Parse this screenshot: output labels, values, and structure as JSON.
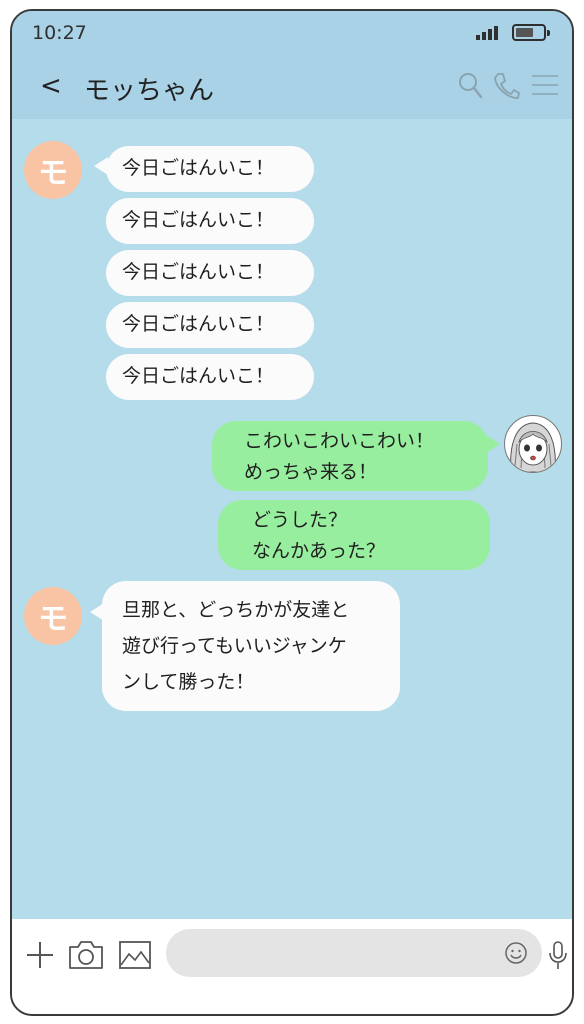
{
  "status": {
    "time": "10:27"
  },
  "header": {
    "back": "<",
    "title": "モッちゃん"
  },
  "contact": {
    "avatar_letter": "モ"
  },
  "messages": [
    {
      "side": "in",
      "text": "今日ごはんいこ！"
    },
    {
      "side": "in",
      "text": "今日ごはんいこ！"
    },
    {
      "side": "in",
      "text": "今日ごはんいこ！"
    },
    {
      "side": "in",
      "text": "今日ごはんいこ！"
    },
    {
      "side": "in",
      "text": "今日ごはんいこ！"
    },
    {
      "side": "out",
      "text": "こわいこわいこわい！\nめっちゃ来る！"
    },
    {
      "side": "out",
      "text": "どうした？\nなんかあった？"
    },
    {
      "side": "in",
      "text": "旦那と、どっちかが友達と\n遊び行ってもいいジャンケ\nンして勝った！"
    }
  ],
  "input": {
    "value": "",
    "placeholder": ""
  },
  "colors": {
    "header": "#a9d2e6",
    "chat_bg": "#b5dcea",
    "incoming": "#fbfbfb",
    "outgoing": "#98ee9f",
    "avatar": "#f9c4a3"
  },
  "icons": [
    "search-icon",
    "phone-icon",
    "menu-icon",
    "plus-icon",
    "camera-icon",
    "image-icon",
    "emoji-icon",
    "mic-icon",
    "signal-icon",
    "battery-icon"
  ]
}
